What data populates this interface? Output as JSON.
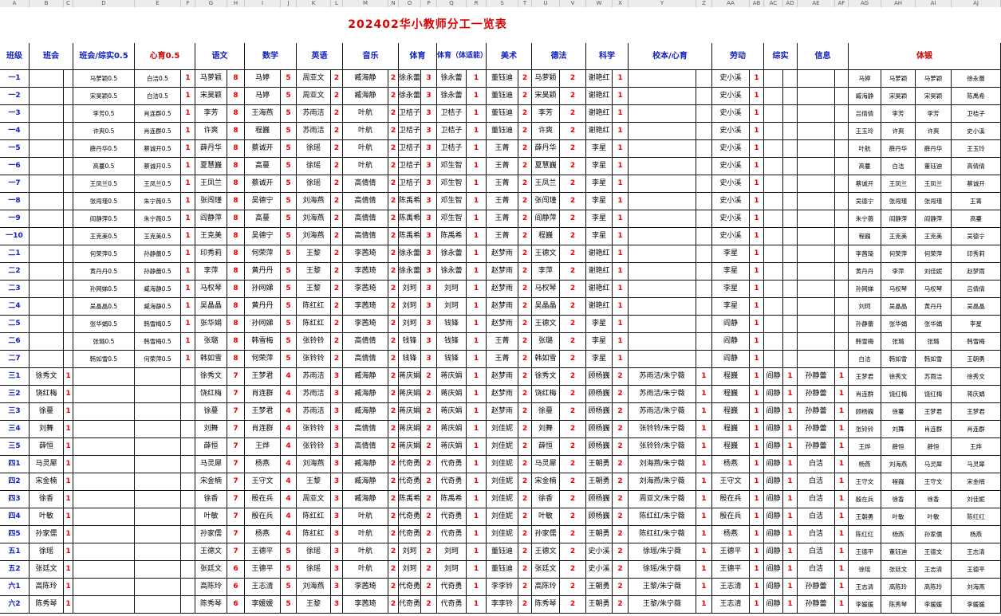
{
  "columns": [
    "A",
    "B",
    "C",
    "D",
    "E",
    "F",
    "G",
    "H",
    "I",
    "J",
    "K",
    "L",
    "M",
    "N",
    "O",
    "P",
    "Q",
    "R",
    "S",
    "T",
    "U",
    "V",
    "W",
    "X",
    "Y",
    "Z",
    "AA",
    "AB",
    "AC",
    "AD",
    "AE",
    "AF",
    "AG",
    "AH",
    "AI",
    "AJ"
  ],
  "title": "202402华小教师分工一览表",
  "headers": {
    "grade": "班级",
    "bz": "班会",
    "bhzs": "班会/综实0.5",
    "xl": "心育0.5",
    "yw": "语文",
    "sx": "数学",
    "yy": "英语",
    "yue": "音乐",
    "ty": "体育",
    "tyz": "体育（体适能）",
    "ms": "美术",
    "df": "德法",
    "kx": "科学",
    "xb": "校本/心育",
    "ld": "劳动",
    "zs": "综实",
    "xx": "信息",
    "tl": "体锻"
  },
  "rows": [
    [
      "一1",
      "",
      "",
      "马萝颖0.5",
      "白洁0.5",
      "1",
      "马萝颖",
      "8",
      "马婷",
      "5",
      "周亚文",
      "2",
      "臧海静",
      "2",
      "徐永蕾",
      "3",
      "徐永蕾",
      "1",
      "董钰迪",
      "2",
      "马萝颖",
      "2",
      "谢艳红",
      "1",
      "",
      "",
      "史小溪",
      "1",
      "",
      "",
      "",
      "",
      "马婷",
      "马萝颖",
      "马萝颖",
      "徐永蕾"
    ],
    [
      "一2",
      "",
      "",
      "宋昊颖0.5",
      "白洁0.5",
      "1",
      "宋昊颖",
      "8",
      "马婷",
      "5",
      "周亚文",
      "2",
      "臧海静",
      "2",
      "徐永蕾",
      "3",
      "徐永蕾",
      "1",
      "董钰迪",
      "2",
      "宋昊颖",
      "2",
      "谢艳红",
      "1",
      "",
      "",
      "史小溪",
      "1",
      "",
      "",
      "",
      "",
      "臧海静",
      "宋昊颖",
      "宋昊颖",
      "陈禹希"
    ],
    [
      "一3",
      "",
      "",
      "李芳0.5",
      "肖连群0.5",
      "1",
      "李芳",
      "8",
      "王海燕",
      "5",
      "苏雨洁",
      "2",
      "叶航",
      "2",
      "卫桔子",
      "3",
      "卫桔子",
      "1",
      "董钰迪",
      "2",
      "李芳",
      "2",
      "谢艳红",
      "1",
      "",
      "",
      "史小溪",
      "1",
      "",
      "",
      "",
      "",
      "吕倩倩",
      "李芳",
      "李芳",
      "卫桔子"
    ],
    [
      "一4",
      "",
      "",
      "许爽0.5",
      "肖连群0.5",
      "1",
      "许爽",
      "8",
      "程巍",
      "5",
      "苏雨洁",
      "2",
      "叶航",
      "2",
      "卫桔子",
      "3",
      "卫桔子",
      "1",
      "董钰迪",
      "2",
      "许爽",
      "2",
      "谢艳红",
      "1",
      "",
      "",
      "史小溪",
      "1",
      "",
      "",
      "",
      "",
      "王玉玲",
      "许爽",
      "许爽",
      "史小溪"
    ],
    [
      "一5",
      "",
      "",
      "薛丹华0.5",
      "蔡诚开0.5",
      "1",
      "薛丹华",
      "8",
      "蔡诚开",
      "5",
      "徐瑶",
      "2",
      "叶航",
      "2",
      "卫桔子",
      "3",
      "卫桔子",
      "1",
      "王菁",
      "2",
      "薛丹华",
      "2",
      "李星",
      "1",
      "",
      "",
      "史小溪",
      "1",
      "",
      "",
      "",
      "",
      "叶航",
      "薛丹华",
      "薛丹华",
      "王玉玲"
    ],
    [
      "一6",
      "",
      "",
      "高蔓0.5",
      "蔡诚开0.5",
      "1",
      "夏慧巍",
      "8",
      "高蔓",
      "5",
      "徐瑶",
      "2",
      "叶航",
      "2",
      "卫桔子",
      "3",
      "邓生智",
      "1",
      "王菁",
      "2",
      "夏慧巍",
      "2",
      "李星",
      "1",
      "",
      "",
      "史小溪",
      "1",
      "",
      "",
      "",
      "",
      "高蔓",
      "白洁",
      "董钰迪",
      "高倩倩"
    ],
    [
      "一7",
      "",
      "",
      "王凤兰0.5",
      "王凤兰0.5",
      "1",
      "王凤兰",
      "8",
      "蔡诚开",
      "5",
      "徐瑶",
      "2",
      "高倩倩",
      "2",
      "卫桔子",
      "3",
      "邓生智",
      "1",
      "王菁",
      "2",
      "王凤兰",
      "2",
      "李星",
      "1",
      "",
      "",
      "史小溪",
      "1",
      "",
      "",
      "",
      "",
      "蔡诚开",
      "王凤兰",
      "王凤兰",
      "蔡诚开"
    ],
    [
      "一8",
      "",
      "",
      "张闯瑾0.5",
      "朱宁薇0.5",
      "1",
      "张闯瑾",
      "8",
      "吴德宁",
      "5",
      "刘海燕",
      "2",
      "高倩倩",
      "2",
      "陈禹希",
      "3",
      "邓生智",
      "1",
      "王菁",
      "2",
      "张闯瑾",
      "2",
      "李星",
      "1",
      "",
      "",
      "史小溪",
      "1",
      "",
      "",
      "",
      "",
      "吴德宁",
      "张闯瑾",
      "张闯瑾",
      "王菁"
    ],
    [
      "一9",
      "",
      "",
      "阎静萍0.5",
      "朱宁薇0.5",
      "1",
      "阎静萍",
      "8",
      "高蔓",
      "5",
      "刘海燕",
      "2",
      "高倩倩",
      "2",
      "陈禹希",
      "3",
      "邓生智",
      "1",
      "王菁",
      "2",
      "阎静萍",
      "2",
      "李星",
      "1",
      "",
      "",
      "史小溪",
      "1",
      "",
      "",
      "",
      "",
      "朱宁薇",
      "阎静萍",
      "阎静萍",
      "高蔓"
    ],
    [
      "一10",
      "",
      "",
      "王克美0.5",
      "王克美0.5",
      "1",
      "王克美",
      "8",
      "吴德宁",
      "5",
      "刘海燕",
      "2",
      "高倩倩",
      "2",
      "陈禹希",
      "3",
      "陈禹希",
      "1",
      "王菁",
      "2",
      "程巍",
      "2",
      "李星",
      "1",
      "",
      "",
      "史小溪",
      "1",
      "",
      "",
      "",
      "",
      "程巍",
      "王克美",
      "王克美",
      "吴德宁"
    ],
    [
      "二1",
      "",
      "",
      "何荣萍0.5",
      "孙静蕾0.5",
      "1",
      "印秀莉",
      "8",
      "何荣萍",
      "5",
      "王黎",
      "2",
      "李茜琦",
      "2",
      "徐永蕾",
      "3",
      "徐永蕾",
      "1",
      "赵梦雨",
      "2",
      "王德文",
      "2",
      "谢艳红",
      "1",
      "",
      "",
      "李星",
      "1",
      "",
      "",
      "",
      "",
      "李茜琦",
      "何荣萍",
      "何荣萍",
      "印秀莉"
    ],
    [
      "二2",
      "",
      "",
      "黄丹丹0.5",
      "孙静蕾0.5",
      "1",
      "李萍",
      "8",
      "黄丹丹",
      "5",
      "王黎",
      "2",
      "李茜琦",
      "2",
      "徐永蕾",
      "3",
      "徐永蕾",
      "1",
      "赵梦雨",
      "2",
      "李萍",
      "2",
      "谢艳红",
      "1",
      "",
      "",
      "李星",
      "1",
      "",
      "",
      "",
      "",
      "黄丹丹",
      "李萍",
      "刘佳妮",
      "赵梦雨"
    ],
    [
      "二3",
      "",
      "",
      "孙网娣0.5",
      "臧海静0.5",
      "1",
      "马权琴",
      "8",
      "孙网娣",
      "5",
      "王黎",
      "2",
      "李茜琦",
      "2",
      "刘珂",
      "3",
      "刘珂",
      "1",
      "赵梦雨",
      "2",
      "马权琴",
      "2",
      "谢艳红",
      "1",
      "",
      "",
      "李星",
      "1",
      "",
      "",
      "",
      "",
      "孙网娣",
      "马权琴",
      "马权琴",
      "吕倩倩"
    ],
    [
      "二4",
      "",
      "",
      "吴晶晶0.5",
      "臧海静0.5",
      "1",
      "吴晶晶",
      "8",
      "黄丹丹",
      "5",
      "陈红红",
      "2",
      "李茜琦",
      "2",
      "刘珂",
      "3",
      "刘珂",
      "1",
      "赵梦雨",
      "2",
      "吴晶晶",
      "2",
      "谢艳红",
      "1",
      "",
      "",
      "李星",
      "1",
      "",
      "",
      "",
      "",
      "刘珂",
      "吴晶晶",
      "黄丹丹",
      "吴晶晶"
    ],
    [
      "二5",
      "",
      "",
      "张华娟0.5",
      "韩雪梅0.5",
      "1",
      "张华娟",
      "8",
      "孙网娣",
      "5",
      "陈红红",
      "2",
      "李茜琦",
      "2",
      "刘珂",
      "3",
      "钱锋",
      "1",
      "赵梦雨",
      "2",
      "王德文",
      "2",
      "李星",
      "1",
      "",
      "",
      "阎静",
      "1",
      "",
      "",
      "",
      "",
      "孙静蕾",
      "张华娟",
      "张华娟",
      "李星"
    ],
    [
      "二6",
      "",
      "",
      "张璐0.5",
      "韩雪梅0.5",
      "1",
      "张璐",
      "8",
      "韩雪梅",
      "5",
      "张铃铃",
      "2",
      "高倩倩",
      "2",
      "钱锋",
      "3",
      "钱锋",
      "1",
      "王菁",
      "2",
      "张璐",
      "2",
      "李星",
      "1",
      "",
      "",
      "阎静",
      "1",
      "",
      "",
      "",
      "",
      "韩雪梅",
      "张璐",
      "张璐",
      "韩雪梅"
    ],
    [
      "二7",
      "",
      "",
      "韩如雪0.5",
      "何荣萍0.5",
      "1",
      "韩如雪",
      "8",
      "何荣萍",
      "5",
      "张铃铃",
      "2",
      "高倩倩",
      "2",
      "钱锋",
      "3",
      "钱锋",
      "1",
      "王菁",
      "2",
      "韩如雪",
      "2",
      "李星",
      "1",
      "",
      "",
      "阎静",
      "1",
      "",
      "",
      "",
      "",
      "白洁",
      "韩如雪",
      "韩如雪",
      "王朝勇"
    ],
    [
      "三1",
      "徐秀文",
      "1",
      "",
      "",
      "",
      "徐秀文",
      "7",
      "王梦君",
      "4",
      "苏雨洁",
      "3",
      "臧海静",
      "2",
      "蒋庆娟",
      "2",
      "蒋庆娟",
      "1",
      "赵梦雨",
      "2",
      "徐秀文",
      "2",
      "顾杨巍",
      "2",
      "苏雨洁/朱宁薇",
      "1",
      "程巍",
      "1",
      "阎静",
      "1",
      "孙静蕾",
      "1",
      "王梦君",
      "徐秀文",
      "苏雨洁",
      "徐秀文"
    ],
    [
      "三2",
      "饶红梅",
      "1",
      "",
      "",
      "",
      "饶红梅",
      "7",
      "肖连群",
      "4",
      "苏雨洁",
      "3",
      "臧海静",
      "2",
      "蒋庆娟",
      "2",
      "蒋庆娟",
      "1",
      "赵梦雨",
      "2",
      "饶红梅",
      "2",
      "顾杨巍",
      "2",
      "苏雨洁/朱宁薇",
      "1",
      "程巍",
      "1",
      "阎静",
      "1",
      "孙静蕾",
      "1",
      "肖连群",
      "饶红梅",
      "饶红梅",
      "蒋庆娟"
    ],
    [
      "三3",
      "徐蔓",
      "1",
      "",
      "",
      "",
      "徐蔓",
      "7",
      "王梦君",
      "4",
      "苏雨洁",
      "3",
      "臧海静",
      "2",
      "蒋庆娟",
      "2",
      "蒋庆娟",
      "1",
      "赵梦雨",
      "2",
      "徐蔓",
      "2",
      "顾杨巍",
      "2",
      "苏雨洁/朱宁薇",
      "1",
      "程巍",
      "1",
      "阎静",
      "1",
      "孙静蕾",
      "1",
      "顾杨巍",
      "徐蔓",
      "王梦君",
      "王梦君"
    ],
    [
      "三4",
      "刘舞",
      "1",
      "",
      "",
      "",
      "刘舞",
      "7",
      "肖连群",
      "4",
      "张铃铃",
      "3",
      "高倩倩",
      "2",
      "蒋庆娟",
      "2",
      "蒋庆娟",
      "1",
      "刘佳妮",
      "2",
      "刘舞",
      "2",
      "顾杨巍",
      "2",
      "张铃铃/朱宁薇",
      "1",
      "程巍",
      "1",
      "阎静",
      "1",
      "孙静蕾",
      "1",
      "张铃铃",
      "刘舞",
      "肖连群",
      "肖连群"
    ],
    [
      "三5",
      "薛恒",
      "1",
      "",
      "",
      "",
      "薛恒",
      "7",
      "王烨",
      "4",
      "张铃铃",
      "3",
      "高倩倩",
      "2",
      "蒋庆娟",
      "2",
      "蒋庆娟",
      "1",
      "刘佳妮",
      "2",
      "薛恒",
      "2",
      "顾杨巍",
      "2",
      "张铃铃/朱宁薇",
      "1",
      "程巍",
      "1",
      "阎静",
      "1",
      "孙静蕾",
      "1",
      "王烨",
      "薛恒",
      "薛恒",
      "王烨"
    ],
    [
      "四1",
      "马灵犀",
      "1",
      "",
      "",
      "",
      "马灵犀",
      "7",
      "杨燕",
      "4",
      "刘海燕",
      "3",
      "臧海静",
      "2",
      "代奇勇",
      "2",
      "代奇勇",
      "1",
      "刘佳妮",
      "2",
      "马灵犀",
      "2",
      "王朝勇",
      "2",
      "刘海燕/朱宁薇",
      "1",
      "杨燕",
      "1",
      "阎静",
      "1",
      "白洁",
      "1",
      "杨燕",
      "刘海燕",
      "马灵犀",
      "马灵犀"
    ],
    [
      "四2",
      "宋金楠",
      "1",
      "",
      "",
      "",
      "宋金楠",
      "7",
      "王守文",
      "4",
      "王黎",
      "3",
      "臧海静",
      "2",
      "代奇勇",
      "2",
      "代奇勇",
      "1",
      "刘佳妮",
      "2",
      "宋金楠",
      "2",
      "王朝勇",
      "2",
      "刘海燕/朱宁薇",
      "1",
      "王守文",
      "1",
      "阎静",
      "1",
      "白洁",
      "1",
      "王守文",
      "程巍",
      "王守文",
      "宋金楠"
    ],
    [
      "四3",
      "徐香",
      "1",
      "",
      "",
      "",
      "徐香",
      "7",
      "殷在兵",
      "4",
      "周亚文",
      "3",
      "臧海静",
      "2",
      "陈禹希",
      "2",
      "陈禹希",
      "1",
      "刘佳妮",
      "2",
      "徐香",
      "2",
      "顾杨巍",
      "2",
      "周亚文/朱宁薇",
      "1",
      "殷在兵",
      "1",
      "阎静",
      "1",
      "白洁",
      "1",
      "殷在兵",
      "徐香",
      "徐香",
      "刘佳妮"
    ],
    [
      "四4",
      "叶敏",
      "1",
      "",
      "",
      "",
      "叶敏",
      "7",
      "殷在兵",
      "4",
      "陈红红",
      "3",
      "叶航",
      "2",
      "代奇勇",
      "2",
      "代奇勇",
      "1",
      "刘佳妮",
      "2",
      "叶敏",
      "2",
      "顾杨巍",
      "2",
      "陈红红/朱宁薇",
      "1",
      "殷在兵",
      "1",
      "阎静",
      "1",
      "白洁",
      "1",
      "王朝勇",
      "叶敏",
      "叶敏",
      "陈红红"
    ],
    [
      "四5",
      "孙家儒",
      "1",
      "",
      "",
      "",
      "孙家儒",
      "7",
      "杨燕",
      "4",
      "陈红红",
      "3",
      "叶航",
      "2",
      "代奇勇",
      "2",
      "代奇勇",
      "1",
      "刘佳妮",
      "2",
      "孙家儒",
      "2",
      "王朝勇",
      "2",
      "陈红红/朱宁薇",
      "1",
      "杨燕",
      "1",
      "阎静",
      "1",
      "白洁",
      "1",
      "陈红红",
      "杨燕",
      "孙家儒",
      "杨燕"
    ],
    [
      "五1",
      "徐瑶",
      "1",
      "",
      "",
      "",
      "王德文",
      "7",
      "王德平",
      "5",
      "徐瑶",
      "3",
      "叶航",
      "2",
      "刘珂",
      "2",
      "刘珂",
      "1",
      "董钰迪",
      "2",
      "王德文",
      "2",
      "史小溪",
      "2",
      "徐瑶/朱宁薇",
      "1",
      "王德平",
      "1",
      "阎静",
      "1",
      "白洁",
      "1",
      "王德平",
      "董钰迪",
      "王德文",
      "王志清"
    ],
    [
      "五2",
      "张廷文",
      "1",
      "",
      "",
      "",
      "张廷文",
      "6",
      "王德平",
      "5",
      "徐瑶",
      "3",
      "叶航",
      "2",
      "刘珂",
      "2",
      "刘珂",
      "1",
      "董钰迪",
      "2",
      "张廷文",
      "2",
      "史小溪",
      "2",
      "徐瑶/朱宁薇",
      "1",
      "王德平",
      "1",
      "阎静",
      "1",
      "白洁",
      "1",
      "徐瑶",
      "张廷文",
      "王志清",
      "王德平"
    ],
    [
      "六1",
      "高陈玲",
      "1",
      "",
      "",
      "",
      "高陈玲",
      "6",
      "王志清",
      "5",
      "刘海燕",
      "3",
      "李茜琦",
      "2",
      "代奇勇",
      "2",
      "代奇勇",
      "1",
      "李李铃",
      "2",
      "高陈玲",
      "2",
      "王朝勇",
      "2",
      "王黎/朱宁薇",
      "1",
      "王志清",
      "1",
      "阎静",
      "1",
      "孙静蕾",
      "1",
      "王志清",
      "高陈玲",
      "高陈玲",
      "刘海燕"
    ],
    [
      "六2",
      "陈秀琴",
      "1",
      "",
      "",
      "",
      "陈秀琴",
      "6",
      "李媛媛",
      "5",
      "王黎",
      "3",
      "李茜琦",
      "2",
      "代奇勇",
      "2",
      "代奇勇",
      "1",
      "李李铃",
      "2",
      "陈秀琴",
      "2",
      "王朝勇",
      "2",
      "王黎/朱宁薇",
      "1",
      "王志清",
      "1",
      "阎静",
      "1",
      "孙静蕾",
      "1",
      "李媛媛",
      "陈秀琴",
      "李媛媛",
      "李媛媛"
    ]
  ]
}
